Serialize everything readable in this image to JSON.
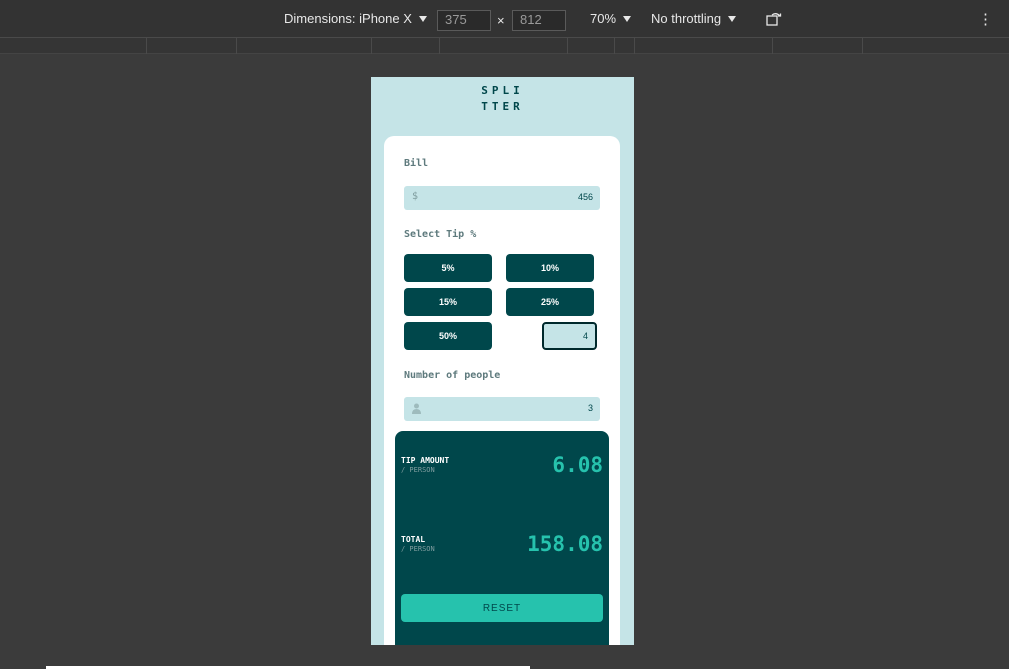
{
  "devtools": {
    "device_label": "Dimensions: iPhone X",
    "width_value": "375",
    "height_value": "812",
    "times_symbol": "×",
    "zoom": "70%",
    "throttling": "No throttling",
    "more_icon": "⋮"
  },
  "app": {
    "logo_line1": "SPLI",
    "logo_line2": "TTER",
    "bill_label": "Bill",
    "bill_prefix": "$",
    "bill_value": "456",
    "tip_label": "Select Tip %",
    "tips": [
      "5%",
      "10%",
      "15%",
      "25%",
      "50%"
    ],
    "custom_tip_value": "4",
    "people_label": "Number of people",
    "people_value": "3",
    "tip_amount_label": "TIP AMOUNT",
    "tip_amount_sub": "/ PERSON",
    "tip_amount_value": "6.08",
    "total_label": "TOTAL",
    "total_sub": "/ PERSON",
    "total_value": "158.08",
    "reset_label": "RESET"
  },
  "colors": {
    "background": "#c5e4e7",
    "dark_cyan": "#00474b",
    "accent": "#26c2ad"
  }
}
